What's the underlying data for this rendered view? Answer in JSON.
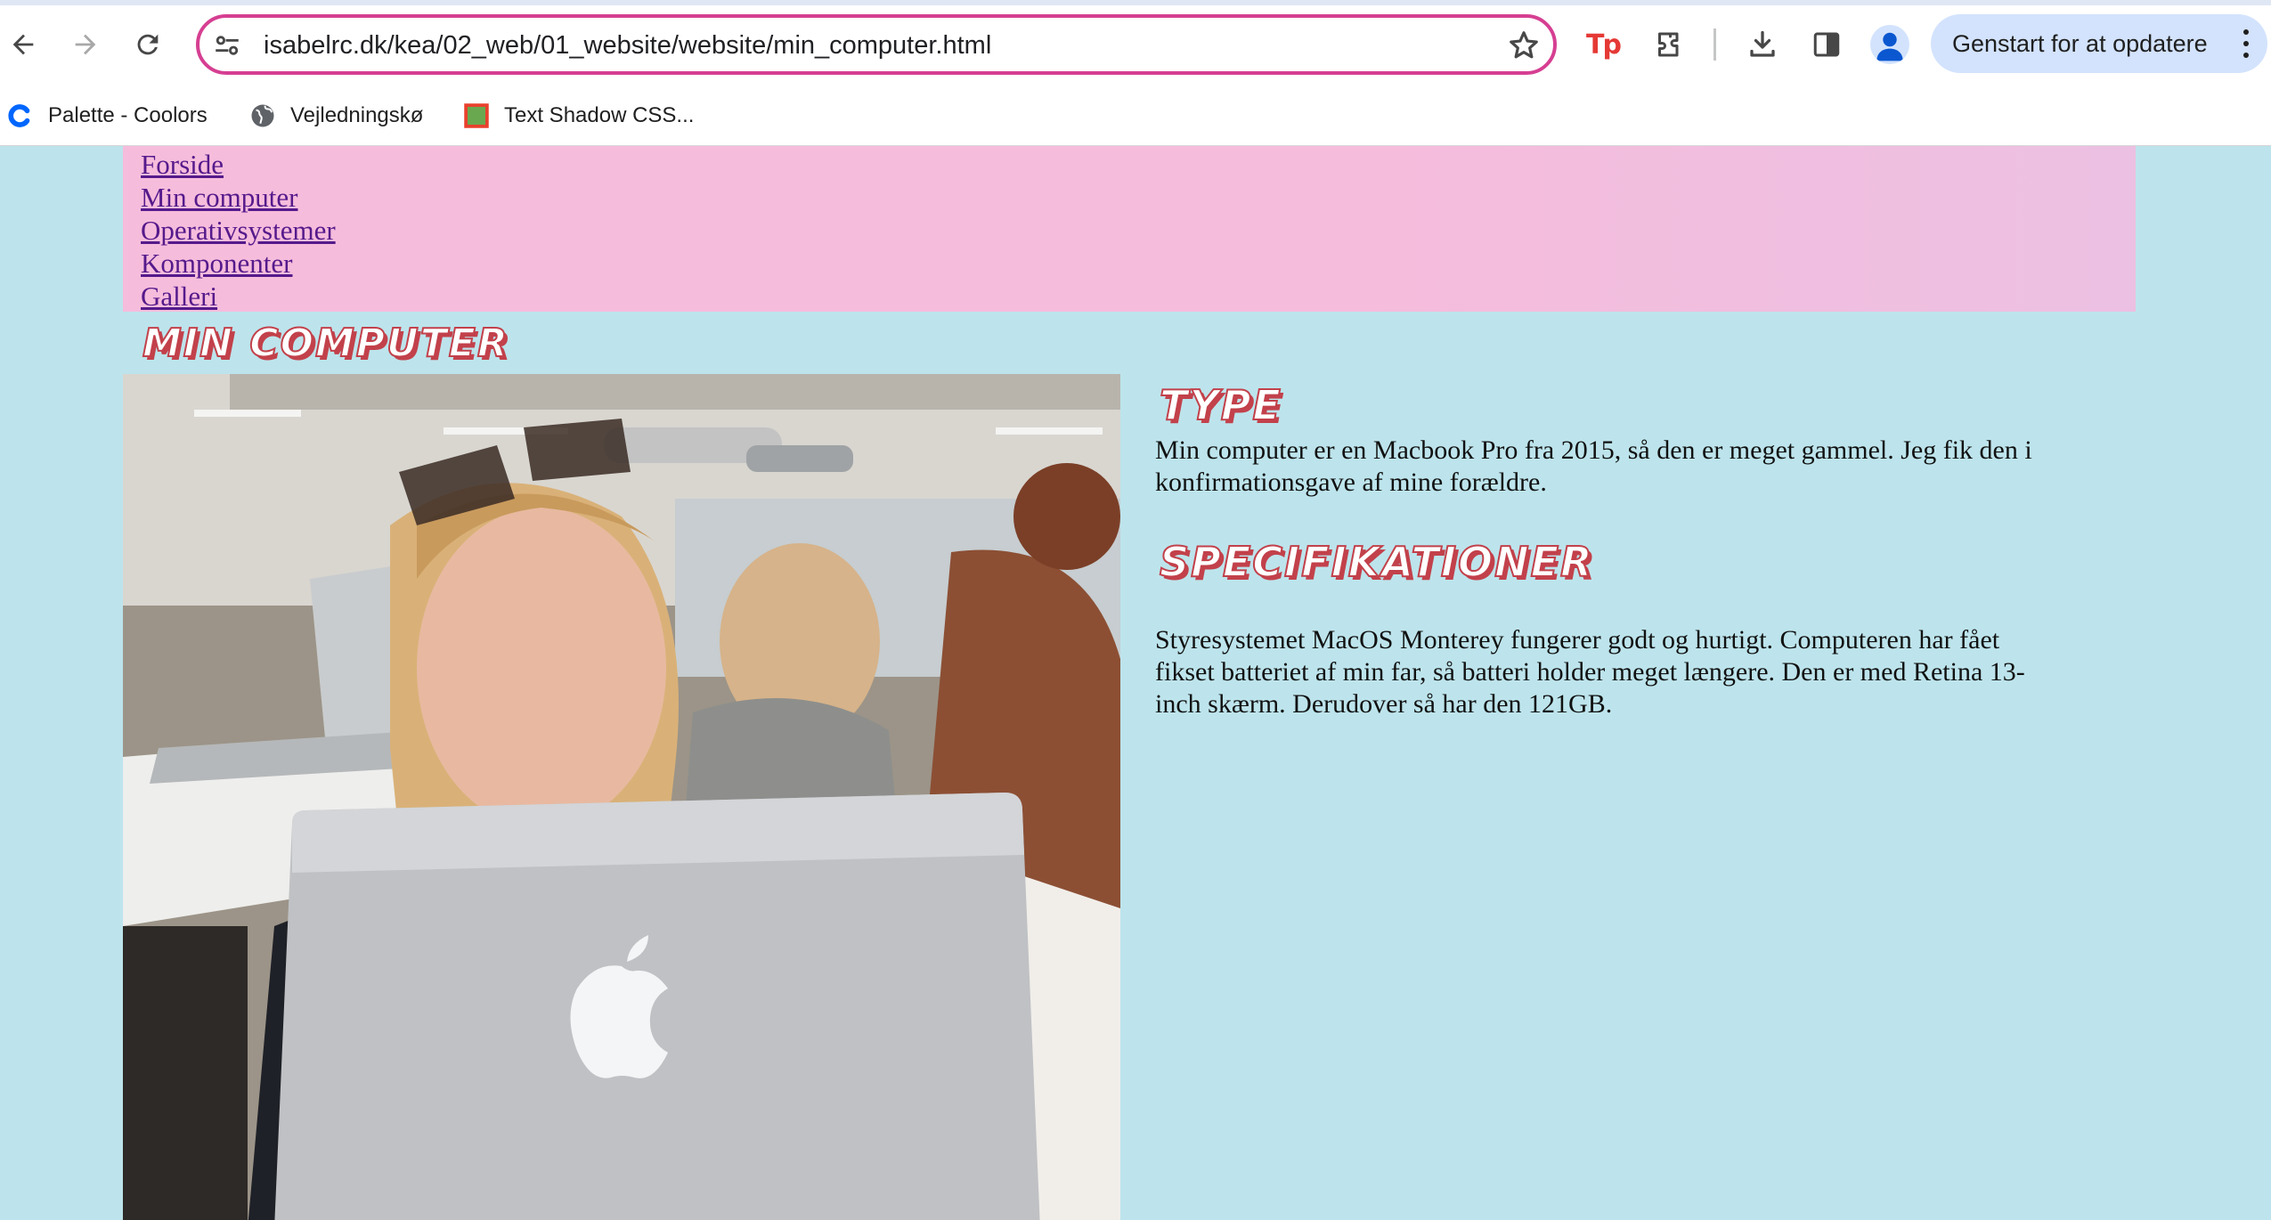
{
  "browser": {
    "url": "isabelrc.dk/kea/02_web/01_website/website/min_computer.html",
    "update_button_label": "Genstart for at opdatere",
    "icons": [
      "back-arrow-icon",
      "forward-arrow-icon",
      "reload-icon",
      "site-settings-icon",
      "bookmark-star-icon",
      "tp-extension-icon",
      "extensions-puzzle-icon",
      "download-icon",
      "side-panel-icon",
      "profile-icon",
      "kebab-menu-icon"
    ],
    "bookmarks": [
      {
        "label": "Palette - Coolors",
        "icon": "coolors-logo-icon"
      },
      {
        "label": "Vejledningskø",
        "icon": "globe-icon"
      },
      {
        "label": "Text Shadow CSS...",
        "icon": "green-square-favicon-icon"
      }
    ]
  },
  "site": {
    "nav": [
      {
        "label": "Forside"
      },
      {
        "label": "Min computer"
      },
      {
        "label": "Operativsystemer"
      },
      {
        "label": "Komponenter"
      },
      {
        "label": "Galleri"
      }
    ],
    "page_title": "Min computer",
    "sections": [
      {
        "heading": "Type",
        "text": "Min computer er en Macbook Pro fra 2015, så den er meget gammel. Jeg fik den i konfirmationsgave af mine forældre."
      },
      {
        "heading": "Specifikationer",
        "text": "Styresystemet MacOS Monterey fungerer godt og hurtigt. Computeren har fået fikset batteriet af min far, så batteri holder meget længere. Den er med Retina 13-inch skærm. Derudover så har den 121GB."
      }
    ]
  },
  "colors": {
    "page_background": "#bde4ec",
    "nav_background": "#f6bcdc",
    "heading_accent": "#c2414b",
    "omnibox_border": "#d63f92",
    "update_chip": "#d3e3fd"
  }
}
